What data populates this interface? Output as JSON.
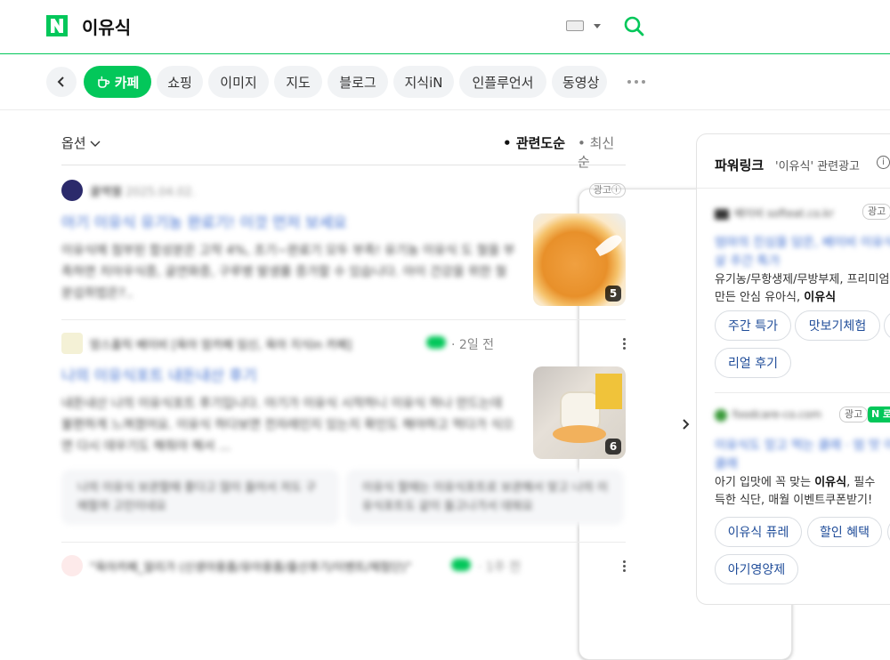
{
  "header": {
    "query": "이유식"
  },
  "tabs": [
    {
      "label": "카페",
      "active": true
    },
    {
      "label": "쇼핑"
    },
    {
      "label": "이미지"
    },
    {
      "label": "지도"
    },
    {
      "label": "블로그"
    },
    {
      "label": "지식iN"
    },
    {
      "label": "인플루언서"
    },
    {
      "label": "동영상"
    }
  ],
  "sort": {
    "options_label": "옵션",
    "relevance": "관련도순",
    "latest": "최신순"
  },
  "results": [
    {
      "source": "쿨맥웰",
      "date": "2025.04.02.",
      "ad_label": "광고",
      "title": "아기 이유식 유기농 완료기! 이것 먼저 보세요",
      "desc": "이유식에 첨부된 합성분은 고작 4%, 초기~완료기 모두 부족! 유기농 이유식 도 철을 부족하면 치아우식증, 골연화증, 구루병 발생률 증가할 수 있습니다. 아이 건강을 위한 철분섭취법은?..",
      "image_count": "5"
    },
    {
      "source": "맘스홀릭 베이비 [육아 맘카페 임신, 육아 지식in 카페]",
      "time": "2일 전",
      "title": "나의 이유식포트 내돈내산 후기",
      "desc": "내돈내산 나의 이유식포트 후기입니다. 아기가 이유식 시작하니 이유식 하나 만드는데 불편하게 느껴졌어요. 이유식 하다보면 전자레인지 있는지 확인도 해야하고 먹다가 식으면 다시 데우기도 해줘야 해서 ...",
      "image_count": "6",
      "sub_posts": [
        "나의 이유식 보관할때 좋다고 많이 들어서 저도 구매할까 고민이네요",
        "이유식 할때는 이유식포트로 보관해서 맞고 나의 이유식포트도 같이 들고나가서 데워요"
      ]
    },
    {
      "source": "\"육아카페_알리가 (신생아용품/유아용품/출산후기/이벤트/체험단)\"",
      "time": "1주 전"
    }
  ],
  "powerlink": {
    "title": "파워링크",
    "subtitle": "'이유식' 관련광고",
    "info": "i",
    "ads": [
      {
        "source": "베이비 softeat.co.kr",
        "ad_label": "광고",
        "title": "엄마의 진심을 담은, 베이비 이유식 독살 주간 특가",
        "desc_line1": "유기농/무항생제/무방부제, 프리미엄",
        "desc_line2_prefix": "만든 안심 유아식, ",
        "desc_line2_bold": "이유식",
        "chips": [
          "주간 특가",
          "맛보기체험",
          "리얼 후기"
        ]
      },
      {
        "source": "foodcare-co.com",
        "ad_label": "광고",
        "n_label": "N 로",
        "title": "이유식도 믿고 먹는 클래 · 엄 맛 이유식 클래",
        "desc_line1_prefix": "아기 입맛에 꼭 맞는 ",
        "desc_line1_bold": "이유식",
        "desc_line1_suffix": ", 필수",
        "desc_line2": "득한 식단, 매월 이벤트쿠폰받기!",
        "chips": [
          "이유식 퓨레",
          "할인 혜택",
          "아기영양제"
        ]
      }
    ]
  },
  "colors": {
    "brand_green": "#03c75a",
    "link_blue": "#3c6ccf",
    "chip_blue": "#1f4c99"
  }
}
